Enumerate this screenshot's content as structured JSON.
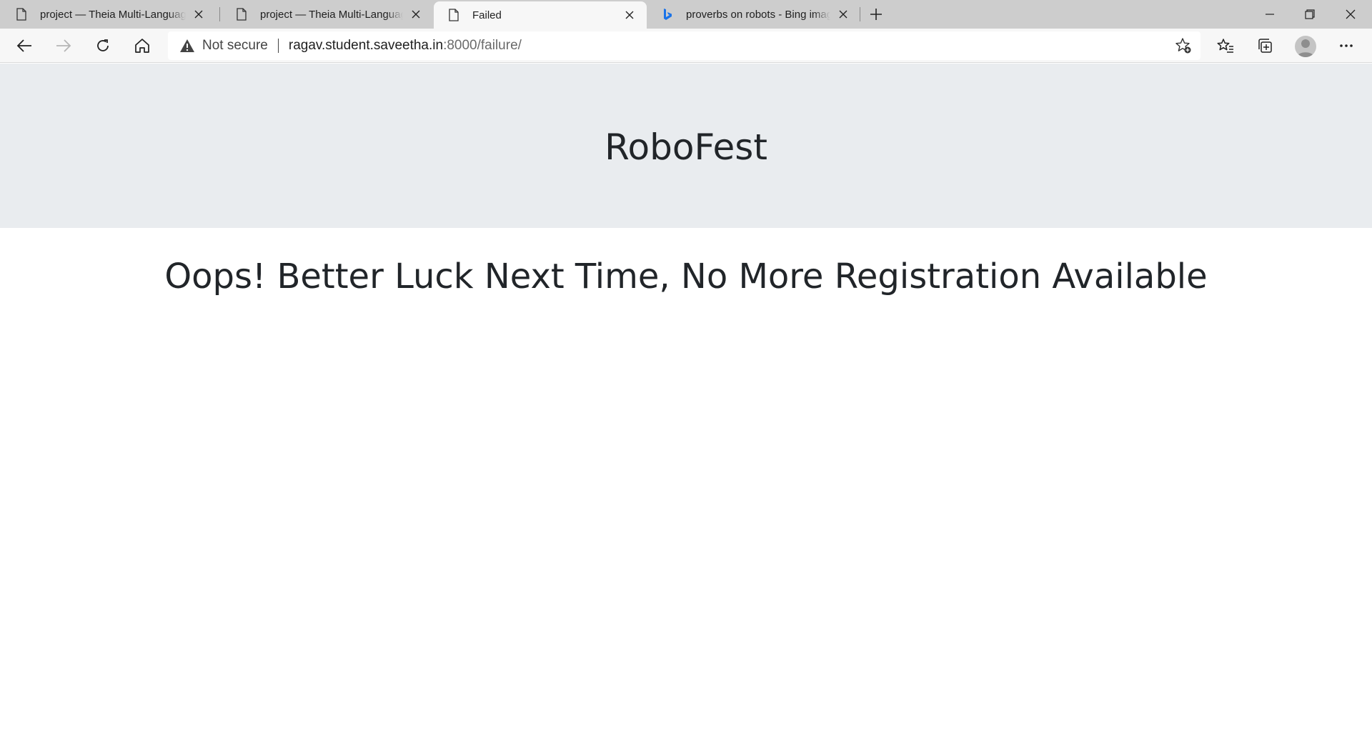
{
  "browser": {
    "tabs": [
      {
        "title": "project — Theia Multi-Language",
        "active": false,
        "icon": "page-icon"
      },
      {
        "title": "project — Theia Multi-Language",
        "active": false,
        "icon": "page-icon"
      },
      {
        "title": "Failed",
        "active": true,
        "icon": "page-icon"
      },
      {
        "title": "proverbs on robots - Bing images",
        "active": false,
        "icon": "bing-icon"
      }
    ],
    "address_bar": {
      "security_label": "Not secure",
      "url_host": "ragav.student.saveetha.in",
      "url_rest": ":8000/failure/"
    },
    "colors": {
      "tabstrip": "#cdcdcd",
      "toolbar": "#f7f7f7",
      "bing_blue": "#1a73e8"
    }
  },
  "page": {
    "header_title": "RoboFest",
    "message": "Oops! Better Luck Next Time, No More Registration Available",
    "colors": {
      "hero_bg": "#e9ecef",
      "text": "#212529"
    }
  }
}
